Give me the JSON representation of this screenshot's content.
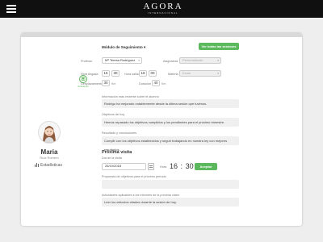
{
  "header": {
    "logo_main": "AGORA",
    "logo_sub": "INTERNACIONAL"
  },
  "toolbar": {
    "module_label": "Módulo de Seguimiento",
    "module_caret": "▾",
    "view_all_label": "Ver todas las sesiones"
  },
  "form": {
    "profesor_label": "Profesor",
    "profesor_value": "Mª Teresa Rodriguez",
    "caret": "▾",
    "asignatura_label": "Asignatura",
    "asignatura_value": "Personalizado",
    "hora_llegada_label": "Hora llegada",
    "hora_llegada_h": "16",
    "hora_llegada_m": "30",
    "hora_salida_label": "Hora salida",
    "hora_salida_h": "18",
    "hora_salida_m": "00",
    "materia_label": "Materia",
    "materia_value": "Exam",
    "desplazamiento_label": "Desplazamiento",
    "desplazamiento_value": "30",
    "desplazamiento_unit": "Km",
    "duracion_label": "Duración",
    "duracion_value": "40",
    "duracion_unit": "Km"
  },
  "recorder": {
    "label": "Grabación"
  },
  "profile": {
    "name": "Maria",
    "surname": "Ruiz Romero",
    "stats_label": "Estadísticas"
  },
  "notes": {
    "info_label": "Información más reciente sobre el alumno",
    "info_value": "Rodrigo ha mejorado notablemente desde la última sesión que tuvimos.",
    "objetivos_label": "Objetivos de hoy",
    "objetivos_value": "Hemos repasado los objetivos cumplidos y los pendientes para el próximo trimestre.",
    "resultado_label": "Resultado y conclusiones",
    "resultado_value": "Cumplir con los objetivos establecidos y seguir trabajando en nuestra ley con mejores resultados."
  },
  "next_visit": {
    "title": "Próxima visita",
    "fecha_label": "Día de la visita",
    "fecha_value": "26/10/2018",
    "hora_label": "Hora",
    "hora_h": "16",
    "hora_m": "30",
    "post_label": "Aceptar",
    "objetivo_label": "Propuesta de objetivos para el próximo período",
    "objetivo_value": "",
    "actividad_label": "Actividades aplicables a los informes de la próxima clase",
    "actividad_value": "Leer los artículos citados durante la sesión de hoy."
  },
  "colors": {
    "accent": "#5cb85c",
    "topbar": "#101010"
  }
}
